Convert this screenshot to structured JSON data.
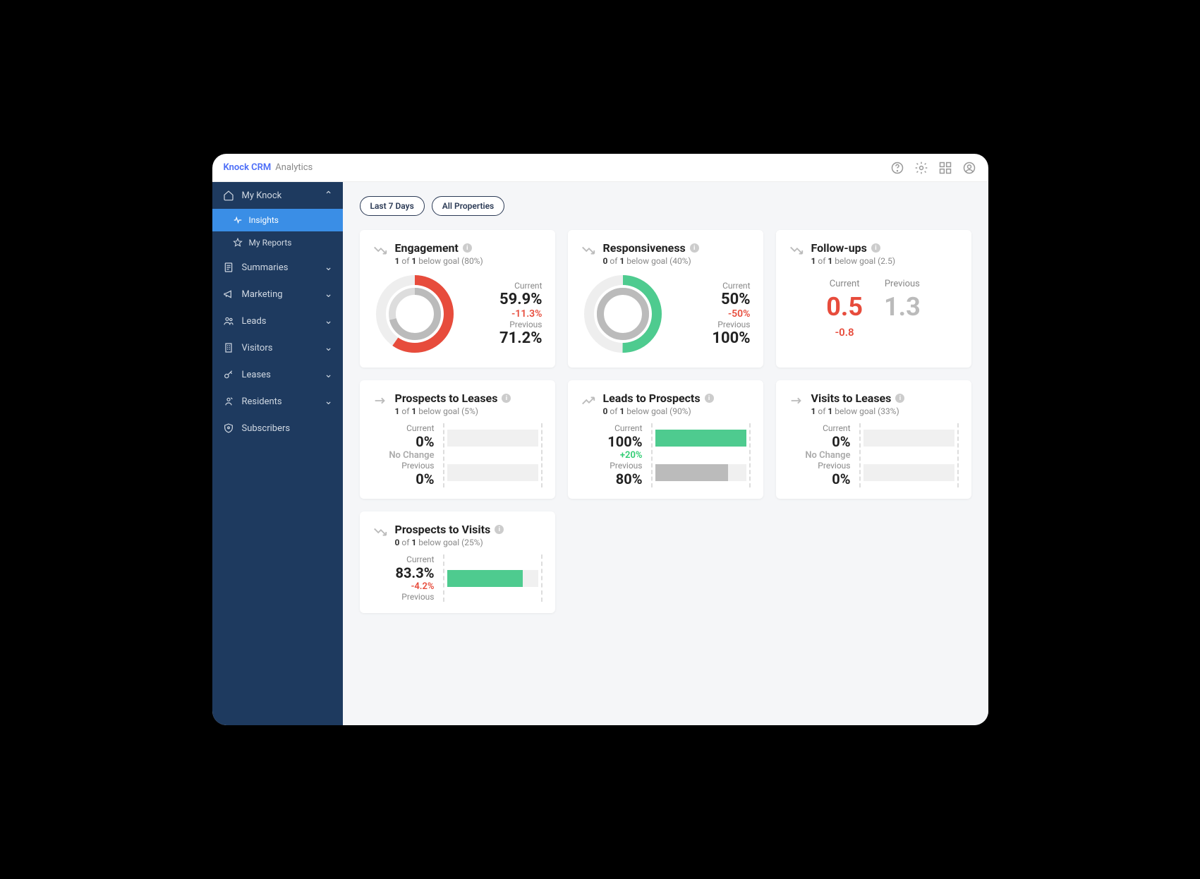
{
  "header": {
    "brand": "Knock CRM",
    "sub": "Analytics"
  },
  "sidebar": {
    "groups": [
      {
        "label": "My Knock",
        "icon": "home",
        "expanded": true,
        "children": [
          {
            "label": "Insights",
            "icon": "pulse",
            "active": true
          },
          {
            "label": "My Reports",
            "icon": "star",
            "active": false
          }
        ]
      },
      {
        "label": "Summaries",
        "icon": "doc"
      },
      {
        "label": "Marketing",
        "icon": "megaphone"
      },
      {
        "label": "Leads",
        "icon": "people"
      },
      {
        "label": "Visitors",
        "icon": "building"
      },
      {
        "label": "Leases",
        "icon": "key"
      },
      {
        "label": "Residents",
        "icon": "resident"
      },
      {
        "label": "Subscribers",
        "icon": "shield",
        "noChevron": true
      }
    ]
  },
  "filters": {
    "range": "Last 7 Days",
    "props": "All Properties"
  },
  "cards": {
    "engagement": {
      "title": "Engagement",
      "sub_pre": "1",
      "sub_mid": " of ",
      "sub_b2": "1",
      "sub_post": " below goal (80%)",
      "trend": "down",
      "current_label": "Current",
      "current": "59.9%",
      "change": "-11.3%",
      "change_class": "neg",
      "previous_label": "Previous",
      "previous": "71.2%",
      "donut_color": "#e74c3c",
      "donut_pct": 59.9,
      "donut_prev": 71.2
    },
    "responsiveness": {
      "title": "Responsiveness",
      "sub_pre": "0",
      "sub_mid": " of ",
      "sub_b2": "1",
      "sub_post": " below goal (40%)",
      "trend": "down",
      "current_label": "Current",
      "current": "50%",
      "change": "-50%",
      "change_class": "neg",
      "previous_label": "Previous",
      "previous": "100%",
      "donut_color": "#4ecb8f",
      "donut_pct": 50,
      "donut_prev": 100
    },
    "followups": {
      "title": "Follow-ups",
      "sub_pre": "1",
      "sub_mid": " of ",
      "sub_b2": "1",
      "sub_post": " below goal (2.5)",
      "trend": "down",
      "current_label": "Current",
      "current": "0.5",
      "previous_label": "Previous",
      "previous": "1.3",
      "change": "-0.8"
    },
    "prospects_leases": {
      "title": "Prospects to Leases",
      "sub_pre": "1",
      "sub_mid": " of ",
      "sub_b2": "1",
      "sub_post": " below goal (5%)",
      "trend": "flat",
      "current_label": "Current",
      "current": "0%",
      "current_pct": 0,
      "change": "No Change",
      "change_class": "nc",
      "previous_label": "Previous",
      "previous": "0%",
      "previous_pct": 0
    },
    "leads_prospects": {
      "title": "Leads to Prospects",
      "sub_pre": "0",
      "sub_mid": " of ",
      "sub_b2": "1",
      "sub_post": " below goal (90%)",
      "trend": "up",
      "current_label": "Current",
      "current": "100%",
      "current_pct": 100,
      "change": "+20%",
      "change_class": "pos",
      "previous_label": "Previous",
      "previous": "80%",
      "previous_pct": 80
    },
    "visits_leases": {
      "title": "Visits to Leases",
      "sub_pre": "1",
      "sub_mid": " of ",
      "sub_b2": "1",
      "sub_post": " below goal (33%)",
      "trend": "flat",
      "current_label": "Current",
      "current": "0%",
      "current_pct": 0,
      "change": "No Change",
      "change_class": "nc",
      "previous_label": "Previous",
      "previous": "0%",
      "previous_pct": 0
    },
    "prospects_visits": {
      "title": "Prospects to Visits",
      "sub_pre": "0",
      "sub_mid": " of ",
      "sub_b2": "1",
      "sub_post": " below goal (25%)",
      "trend": "down",
      "current_label": "Current",
      "current": "83.3%",
      "current_pct": 83.3,
      "change": "-4.2%",
      "change_class": "neg",
      "previous_label": "Previous",
      "previous": ""
    }
  },
  "chart_data": [
    {
      "type": "pie",
      "title": "Engagement",
      "series": [
        {
          "name": "Current",
          "value": 59.9
        },
        {
          "name": "Previous",
          "value": 71.2
        }
      ],
      "unit": "%",
      "goal": 80,
      "change": -11.3
    },
    {
      "type": "pie",
      "title": "Responsiveness",
      "series": [
        {
          "name": "Current",
          "value": 50
        },
        {
          "name": "Previous",
          "value": 100
        }
      ],
      "unit": "%",
      "goal": 40,
      "change": -50
    },
    {
      "type": "table",
      "title": "Follow-ups",
      "series": [
        {
          "name": "Current",
          "value": 0.5
        },
        {
          "name": "Previous",
          "value": 1.3
        }
      ],
      "goal": 2.5,
      "change": -0.8
    },
    {
      "type": "bar",
      "title": "Prospects to Leases",
      "categories": [
        "Current",
        "Previous"
      ],
      "values": [
        0,
        0
      ],
      "unit": "%",
      "goal": 5,
      "change": 0
    },
    {
      "type": "bar",
      "title": "Leads to Prospects",
      "categories": [
        "Current",
        "Previous"
      ],
      "values": [
        100,
        80
      ],
      "unit": "%",
      "goal": 90,
      "change": 20
    },
    {
      "type": "bar",
      "title": "Visits to Leases",
      "categories": [
        "Current",
        "Previous"
      ],
      "values": [
        0,
        0
      ],
      "unit": "%",
      "goal": 33,
      "change": 0
    },
    {
      "type": "bar",
      "title": "Prospects to Visits",
      "categories": [
        "Current",
        "Previous"
      ],
      "values": [
        83.3,
        null
      ],
      "unit": "%",
      "goal": 25,
      "change": -4.2
    }
  ]
}
